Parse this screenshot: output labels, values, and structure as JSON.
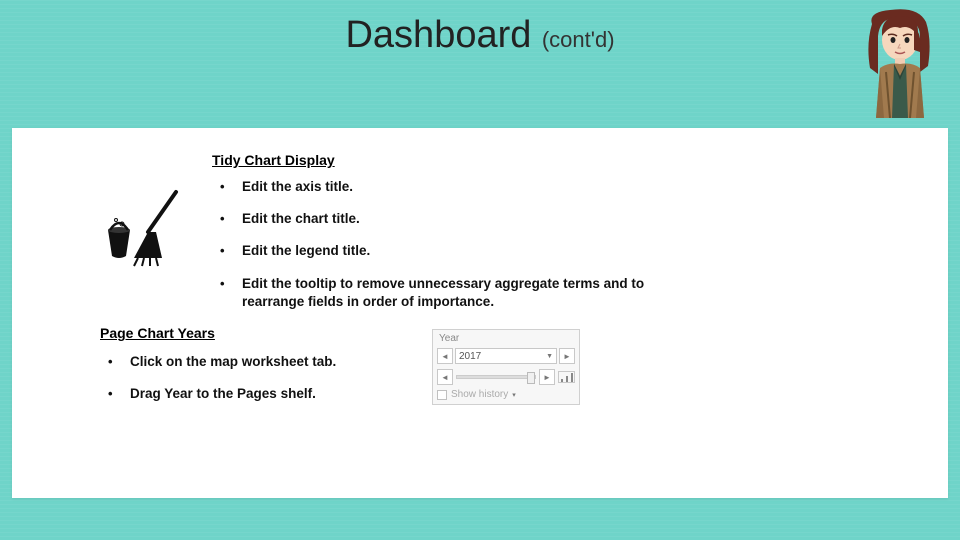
{
  "title": {
    "main": "Dashboard",
    "sub": "(cont'd)"
  },
  "section1": {
    "heading": "Tidy Chart Display",
    "bullets": [
      "Edit the axis title.",
      "Edit the chart title.",
      "Edit the legend title.",
      "Edit the tooltip to remove unnecessary aggregate terms and to rearrange fields in order of importance."
    ]
  },
  "section2": {
    "heading": "Page Chart Years",
    "bullets": [
      "Click on the map worksheet tab.",
      "Drag Year to the Pages shelf."
    ]
  },
  "pagesPanel": {
    "label": "Year",
    "value": "2017",
    "history": "Show history"
  }
}
